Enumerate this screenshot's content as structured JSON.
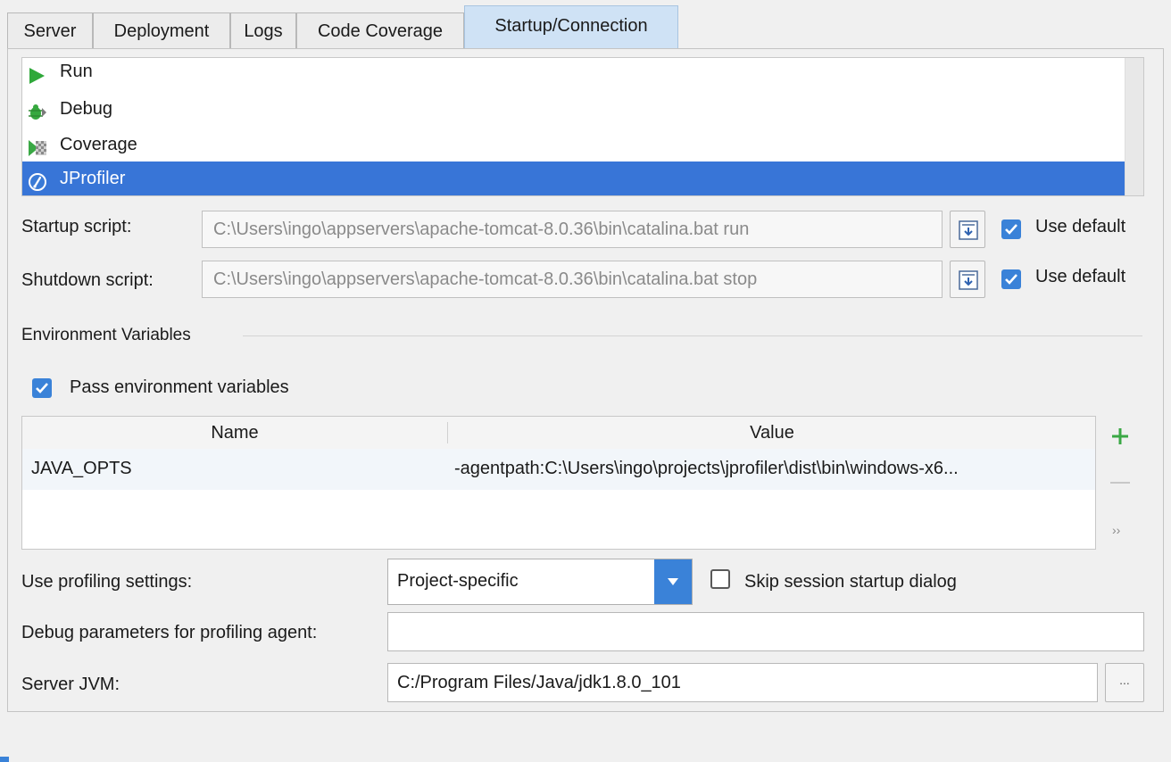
{
  "tabs": [
    "Server",
    "Deployment",
    "Logs",
    "Code Coverage",
    "Startup/Connection"
  ],
  "modes": [
    {
      "label": "Run",
      "icon": "run-icon"
    },
    {
      "label": "Debug",
      "icon": "debug-icon"
    },
    {
      "label": "Coverage",
      "icon": "coverage-icon"
    },
    {
      "label": "JProfiler",
      "icon": "jprofiler-icon",
      "selected": true
    }
  ],
  "startup": {
    "label": "Startup script:",
    "value": "C:\\Users\\ingo\\appservers\\apache-tomcat-8.0.36\\bin\\catalina.bat run",
    "use_default": "Use default",
    "checked": true
  },
  "shutdown": {
    "label": "Shutdown script:",
    "value": "C:\\Users\\ingo\\appservers\\apache-tomcat-8.0.36\\bin\\catalina.bat stop",
    "use_default": "Use default",
    "checked": true
  },
  "env": {
    "section_title": "Environment Variables",
    "pass_label": "Pass environment variables",
    "pass_checked": true,
    "columns": [
      "Name",
      "Value"
    ],
    "rows": [
      {
        "name": "JAVA_OPTS",
        "value": "-agentpath:C:\\Users\\ingo\\projects\\jprofiler\\dist\\bin\\windows-x6..."
      }
    ],
    "more_glyph": "››"
  },
  "profiling": {
    "label": "Use profiling settings:",
    "selected": "Project-specific",
    "skip_label": "Skip session startup dialog",
    "skip_checked": false
  },
  "debug_params": {
    "label": "Debug parameters for profiling agent:",
    "value": ""
  },
  "jvm": {
    "label": "Server JVM:",
    "value": "C:/Program Files/Java/jdk1.8.0_101",
    "browse_label": "..."
  },
  "colors": {
    "accent": "#3875d7",
    "checkbox": "#3a82d8",
    "active_tab": "#cfe2f5",
    "run_green": "#2fa83a"
  }
}
